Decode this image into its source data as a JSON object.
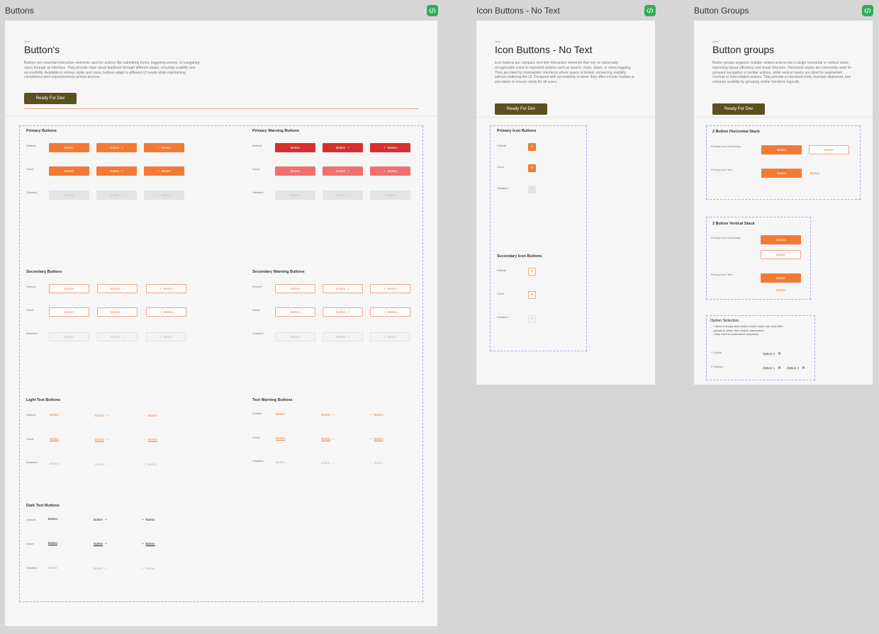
{
  "frames": {
    "buttons": {
      "frame_title": "Buttons",
      "caption": "Grid",
      "title": "Button's",
      "description": "Buttons are essential interactive elements used for actions like submitting forms, triggering events, or navigating users through an interface. They provide clear visual feedback through different states, ensuring usability and accessibility. Available in various styles and sizes, buttons adapt to different UI needs while maintaining consistency and responsiveness across devices.",
      "status": "Ready For Dev"
    },
    "icon": {
      "frame_title": "Icon Buttons - No Text",
      "caption": "Grid",
      "title": "Icon Buttons - No Text",
      "description": "Icon buttons are compact, text-free interactive elements that rely on universally recognizable icons to represent actions such as search, close, share, or menu toggling. They are ideal for minimalistic interfaces where space is limited, enhancing usability without cluttering the UI. Designed with accessibility in mind, they often include tooltips or aria labels to ensure clarity for all users.",
      "status": "Ready For Dev"
    },
    "groups": {
      "frame_title": "Button Groups",
      "caption": "Grid",
      "title": "Button groups",
      "description": "Button groups organize multiple related actions into a single horizontal or vertical stack, improving layout efficiency and visual structure. Horizontal stacks are commonly used for grouped navigation or toolbar actions, while vertical stacks are ideal for segmented controls or form-related actions. They provide a consistent look, maintain alignment, and enhance usability by grouping similar functions logically.",
      "status": "Ready For Dev"
    }
  },
  "sections": {
    "primary": "Primary Buttons",
    "primary_warning": "Primary Warning Buttons",
    "secondary": "Secondary Buttons",
    "secondary_warning": "Secondary Warning Buttons",
    "light_text": "Light Text Buttons",
    "text_warning": "Text Warning Buttons",
    "dark_text": "Dark Text Buttons",
    "primary_icon": "Primary Icon Buttons",
    "secondary_icon": "Secondary Icon Buttons",
    "h_stack": "2 Button Horizontal Stack",
    "v_stack": "2 Button Vertical Stack",
    "option": "Option Selection"
  },
  "states": {
    "default": "Default",
    "hover": "Hover",
    "disabled": "Disabled"
  },
  "button_label": "Button",
  "group_labels": {
    "primary_secondary": "Primary And Secondary",
    "primary_text": "Primary And Text"
  },
  "option": {
    "bullets": [
      "Used in empty state tables where users can clear filter options to refine their search parameters",
      "Also used in multi-select dropdown"
    ],
    "one_label": "1 Option",
    "two_label": "2 Options",
    "option1": "Option 1",
    "option2": "Option 2"
  },
  "colors": {
    "primary": "#f37a35",
    "warning": "#d72f2f",
    "status_badge": "#5a5120",
    "code_badge": "#2fae5a"
  }
}
